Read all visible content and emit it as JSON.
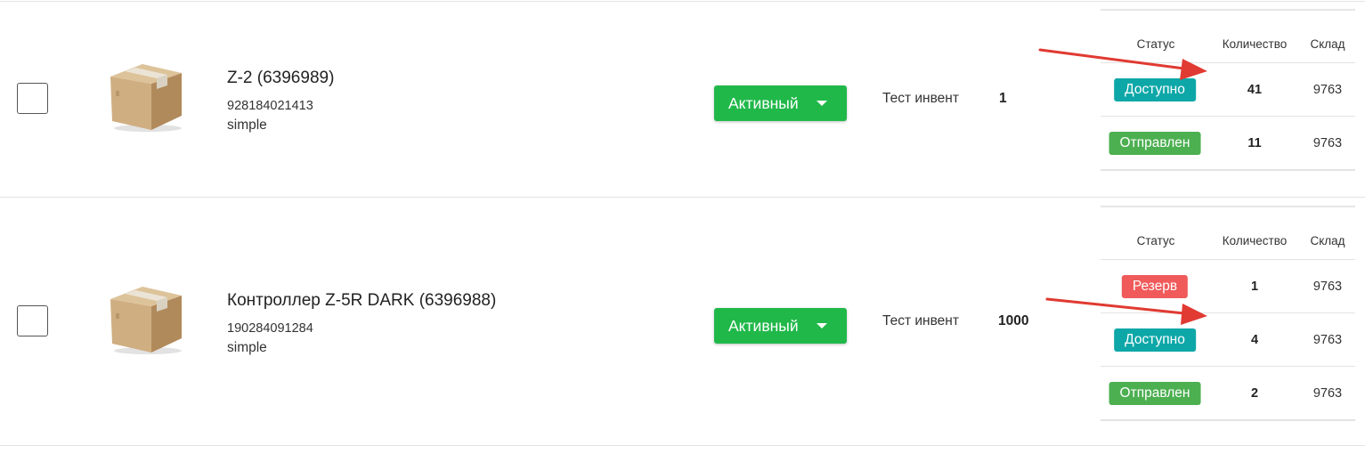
{
  "colors": {
    "active_button": "#21b84a",
    "badge_available": "#0ea7a8",
    "badge_shipped": "#4caf50",
    "badge_reserve": "#f05a5a",
    "annotation_arrow": "#e03a32"
  },
  "stock_headers": {
    "status": "Статус",
    "quantity": "Количество",
    "warehouse": "Склад"
  },
  "products": [
    {
      "name": "Z-2 (6396989)",
      "barcode": "928184021413",
      "type": "simple",
      "thumbnail_icon": "cardboard-box-icon",
      "status_label": "Активный",
      "inventory_name": "Тест инвент",
      "inventory_qty": "1",
      "stock": [
        {
          "status": "Доступно",
          "status_color": "#0ea7a8",
          "qty": "41",
          "warehouse": "9763"
        },
        {
          "status": "Отправлен",
          "status_color": "#4caf50",
          "qty": "11",
          "warehouse": "9763"
        }
      ]
    },
    {
      "name": "Контроллер Z-5R DARK (6396988)",
      "barcode": "190284091284",
      "type": "simple",
      "thumbnail_icon": "cardboard-box-icon",
      "status_label": "Активный",
      "inventory_name": "Тест инвент",
      "inventory_qty": "1000",
      "stock": [
        {
          "status": "Резерв",
          "status_color": "#f05a5a",
          "qty": "1",
          "warehouse": "9763"
        },
        {
          "status": "Доступно",
          "status_color": "#0ea7a8",
          "qty": "4",
          "warehouse": "9763"
        },
        {
          "status": "Отправлен",
          "status_color": "#4caf50",
          "qty": "2",
          "warehouse": "9763"
        }
      ]
    }
  ]
}
